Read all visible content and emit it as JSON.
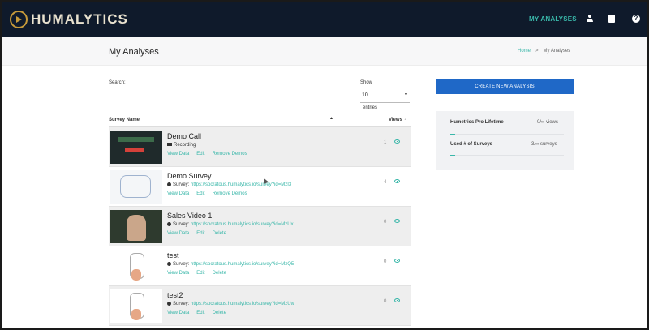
{
  "app": {
    "brand": "HUMALYTICS"
  },
  "nav": {
    "my_analyses": "MY ANALYSES",
    "user_icon": "user-icon",
    "book_icon": "book-icon",
    "help_icon": "help-icon",
    "help_glyph": "?"
  },
  "page": {
    "title": "My Analyses"
  },
  "breadcrumb": {
    "home": "Home",
    "separator": ">",
    "current": "My Analyses"
  },
  "filters": {
    "search_label": "Search:",
    "search_value": "",
    "show_label": "Show",
    "show_value": "10",
    "entries_label": "entries"
  },
  "table": {
    "col_survey": "Survey Name",
    "col_views": "Views",
    "sort_glyph": "▲",
    "sort_glyph2": "↕",
    "rows": [
      {
        "name": "Demo Call",
        "meta_type": "recording",
        "meta_text": "Recording",
        "url": "",
        "actions": [
          "View Data",
          "Edit",
          "Remove Demos"
        ],
        "views": "1"
      },
      {
        "name": "Demo Survey",
        "meta_type": "survey",
        "meta_text": "Survey:",
        "url": "https://socratous.humalytics.io/survey?id=MzI3",
        "actions": [
          "View Data",
          "Edit",
          "Remove Demos"
        ],
        "views": "4"
      },
      {
        "name": "Sales Video 1",
        "meta_type": "survey",
        "meta_text": "Survey:",
        "url": "https://socratous.humalytics.io/survey?id=MzUx",
        "actions": [
          "View Data",
          "Edit",
          "Delete"
        ],
        "views": "0"
      },
      {
        "name": "test",
        "meta_type": "survey",
        "meta_text": "Survey:",
        "url": "https://socratous.humalytics.io/survey?id=MzQ5",
        "actions": [
          "View Data",
          "Edit",
          "Delete"
        ],
        "views": "0"
      },
      {
        "name": "test2",
        "meta_type": "survey",
        "meta_text": "Survey:",
        "url": "https://socratous.humalytics.io/survey?id=MzUw",
        "actions": [
          "View Data",
          "Edit",
          "Delete"
        ],
        "views": "0"
      }
    ]
  },
  "sidebar": {
    "create_button": "CREATE NEW ANALYSIS",
    "plan_name": "Humetrics Pro Lifetime",
    "plan_views": "0/∞ views",
    "plan_views_fraction": 0.04,
    "surveys_label": "Used # of Surveys",
    "surveys_value": "3/∞ surveys",
    "surveys_fraction": 0.04
  },
  "colors": {
    "accent": "#39b7a9",
    "primary": "#1f68c7",
    "topbar": "#0f1a2b",
    "logo": "#c69a3a"
  }
}
